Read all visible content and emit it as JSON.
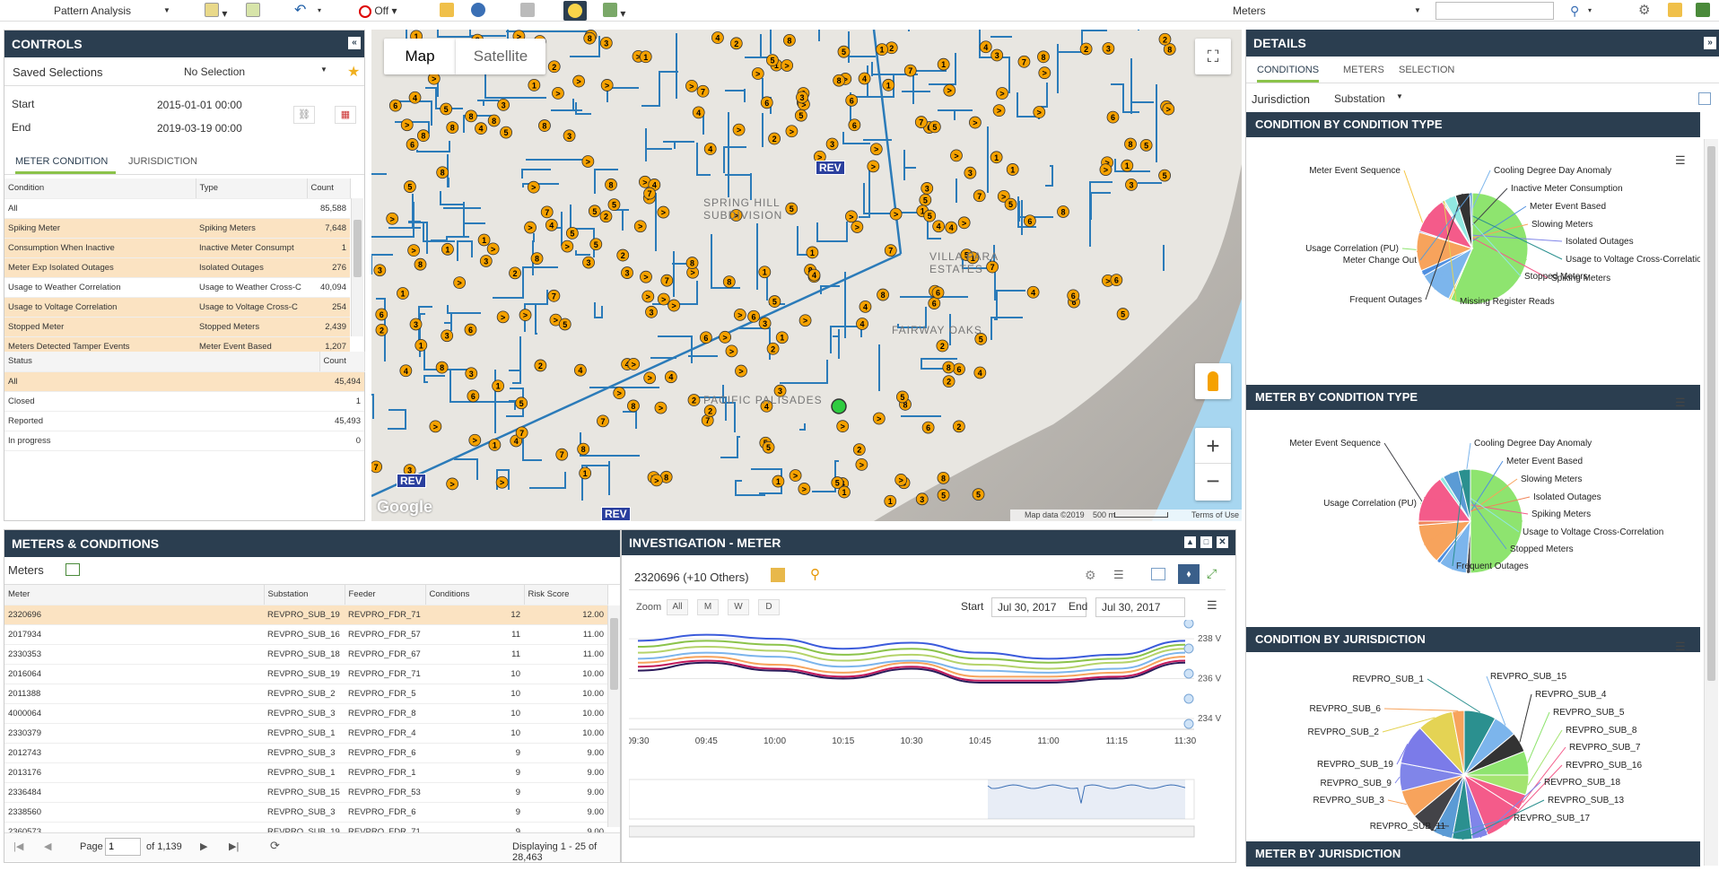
{
  "toolbar": {
    "view_selector": "Pattern Analysis",
    "alerts_toggle": "Off",
    "layer_selector": "Meters",
    "search_placeholder": ""
  },
  "controls": {
    "title": "CONTROLS",
    "saved_selections_label": "Saved Selections",
    "saved_selections_value": "No Selection",
    "start_label": "Start",
    "start_value": "2015-01-01 00:00",
    "end_label": "End",
    "end_value": "2019-03-19 00:00",
    "tabs": [
      "METER CONDITION",
      "JURISDICTION"
    ],
    "condition_headers": [
      "Condition",
      "Type",
      "Count"
    ],
    "conditions": [
      {
        "condition": "All",
        "type": "",
        "count": "85,588"
      },
      {
        "condition": "Spiking Meter",
        "type": "Spiking Meters",
        "count": "7,648"
      },
      {
        "condition": "Consumption When Inactive",
        "type": "Inactive Meter Consumpt",
        "count": "1"
      },
      {
        "condition": "Meter Exp Isolated Outages",
        "type": "Isolated Outages",
        "count": "276"
      },
      {
        "condition": "Usage to Weather Correlation",
        "type": "Usage to Weather Cross-C",
        "count": "40,094"
      },
      {
        "condition": "Usage to Voltage Correlation",
        "type": "Usage to Voltage Cross-C",
        "count": "254"
      },
      {
        "condition": "Stopped Meter",
        "type": "Stopped Meters",
        "count": "2,439"
      },
      {
        "condition": "Meters Detected Tamper Events",
        "type": "Meter Event Based",
        "count": "1,207"
      }
    ],
    "status_headers": [
      "Status",
      "Count"
    ],
    "statuses": [
      {
        "status": "All",
        "count": "45,494"
      },
      {
        "status": "Closed",
        "count": "1"
      },
      {
        "status": "Reported",
        "count": "45,493"
      },
      {
        "status": "In progress",
        "count": "0"
      }
    ]
  },
  "map": {
    "map_type_tabs": [
      "Map",
      "Satellite"
    ],
    "place_labels": [
      "SPRING HILL SUBDIVISION",
      "VILLA PARA ESTATES",
      "PACIFIC PALISADES",
      "FAIRWAY OAKS"
    ],
    "attribution": "Map data ©2019",
    "scale": "500 m",
    "terms": "Terms of Use",
    "logo": "Google",
    "rev_badges": [
      "REV",
      "REV",
      "REV"
    ]
  },
  "meters_conditions": {
    "title": "METERS & CONDITIONS",
    "subtitle": "Meters",
    "headers": [
      "Meter",
      "Substation",
      "Feeder",
      "Conditions",
      "Risk Score"
    ],
    "rows": [
      {
        "meter": "2320696",
        "substation": "REVPRO_SUB_19",
        "feeder": "REVPRO_FDR_71",
        "conditions": "12",
        "risk": "12.00"
      },
      {
        "meter": "2017934",
        "substation": "REVPRO_SUB_16",
        "feeder": "REVPRO_FDR_57",
        "conditions": "11",
        "risk": "11.00"
      },
      {
        "meter": "2330353",
        "substation": "REVPRO_SUB_18",
        "feeder": "REVPRO_FDR_67",
        "conditions": "11",
        "risk": "11.00"
      },
      {
        "meter": "2016064",
        "substation": "REVPRO_SUB_19",
        "feeder": "REVPRO_FDR_71",
        "conditions": "10",
        "risk": "10.00"
      },
      {
        "meter": "2011388",
        "substation": "REVPRO_SUB_2",
        "feeder": "REVPRO_FDR_5",
        "conditions": "10",
        "risk": "10.00"
      },
      {
        "meter": "4000064",
        "substation": "REVPRO_SUB_3",
        "feeder": "REVPRO_FDR_8",
        "conditions": "10",
        "risk": "10.00"
      },
      {
        "meter": "2330379",
        "substation": "REVPRO_SUB_1",
        "feeder": "REVPRO_FDR_4",
        "conditions": "10",
        "risk": "10.00"
      },
      {
        "meter": "2012743",
        "substation": "REVPRO_SUB_3",
        "feeder": "REVPRO_FDR_6",
        "conditions": "9",
        "risk": "9.00"
      },
      {
        "meter": "2013176",
        "substation": "REVPRO_SUB_1",
        "feeder": "REVPRO_FDR_1",
        "conditions": "9",
        "risk": "9.00"
      },
      {
        "meter": "2336484",
        "substation": "REVPRO_SUB_15",
        "feeder": "REVPRO_FDR_53",
        "conditions": "9",
        "risk": "9.00"
      },
      {
        "meter": "2338560",
        "substation": "REVPRO_SUB_3",
        "feeder": "REVPRO_FDR_6",
        "conditions": "9",
        "risk": "9.00"
      },
      {
        "meter": "2360573",
        "substation": "REVPRO_SUB_19",
        "feeder": "REVPRO_FDR_71",
        "conditions": "9",
        "risk": "9.00"
      }
    ],
    "pager": {
      "page_label": "Page",
      "page": "1",
      "of": "of 1,139",
      "displaying": "Displaying 1 - 25 of 28,463"
    }
  },
  "investigation": {
    "title": "INVESTIGATION - METER",
    "meter_label": "2320696 (+10 Others)",
    "zoom_label": "Zoom",
    "zoom_buttons": [
      "All",
      "M",
      "W",
      "D"
    ],
    "start_label": "Start",
    "start_value": "Jul 30, 2017",
    "end_label": "End",
    "end_value": "Jul 30, 2017",
    "y_ticks": [
      "238 V",
      "236 V",
      "234 V"
    ],
    "x_ticks": [
      "09:30",
      "09:45",
      "10:00",
      "10:15",
      "10:30",
      "10:45",
      "11:00",
      "11:15",
      "11:30"
    ]
  },
  "details": {
    "title": "DETAILS",
    "tabs": [
      "CONDITIONS",
      "METERS",
      "SELECTION"
    ],
    "jurisdiction_label": "Jurisdiction",
    "jurisdiction_value": "Substation",
    "chart1_title": "CONDITION BY CONDITION TYPE",
    "chart2_title": "METER BY CONDITION TYPE",
    "chart3_title": "CONDITION BY JURISDICTION",
    "chart4_title": "METER BY JURISDICTION",
    "chart1_labels": [
      "Meter Event Sequence",
      "Cooling Degree Day Anomaly",
      "Inactive Meter Consumption",
      "Meter Event Based",
      "Slowing Meters",
      "Usage Correlation (PU)",
      "Isolated Outages",
      "Meter Change Out",
      "Spiking Meters",
      "Frequent Outages",
      "Usage to Voltage Cross-Correlation",
      "Stopped Meters",
      "Missing Register Reads"
    ],
    "chart2_labels": [
      "Meter Event Sequence",
      "Cooling Degree Day Anomaly",
      "Meter Event Based",
      "Slowing Meters",
      "Isolated Outages",
      "Usage Correlation (PU)",
      "Spiking Meters",
      "Usage to Voltage Cross-Correlation",
      "Stopped Meters",
      "Frequent Outages"
    ],
    "chart3_labels": [
      "REVPRO_SUB_1",
      "REVPRO_SUB_15",
      "REVPRO_SUB_4",
      "REVPRO_SUB_6",
      "REVPRO_SUB_5",
      "REVPRO_SUB_8",
      "REVPRO_SUB_2",
      "REVPRO_SUB_7",
      "REVPRO_SUB_16",
      "REVPRO_SUB_19",
      "REVPRO_SUB_18",
      "REVPRO_SUB_9",
      "REVPRO_SUB_13",
      "REVPRO_SUB_3",
      "REVPRO_SUB_17",
      "REVPRO_SUB_11"
    ]
  },
  "colors": {
    "header_bg": "#2b3e50",
    "accent": "#8bc34a",
    "highlight_row": "#fbe3c2",
    "marker": "#f5a100",
    "pipe": "#2b7bb9"
  },
  "chart_data": [
    {
      "type": "pie",
      "title": "CONDITION BY CONDITION TYPE",
      "series": [
        {
          "values": [
            {
              "label": "Usage Correlation (PU)",
              "value": 40094
            },
            {
              "label": "Meter Event Sequence",
              "value": 400
            },
            {
              "label": "Cooling Degree Day Anomaly",
              "value": 7000
            },
            {
              "label": "Inactive Meter Consumption",
              "value": 1
            },
            {
              "label": "Meter Event Based",
              "value": 1207
            },
            {
              "label": "Slowing Meters",
              "value": 8000
            },
            {
              "label": "Isolated Outages",
              "value": 276
            },
            {
              "label": "Spiking Meters",
              "value": 7648
            },
            {
              "label": "Usage to Voltage Cross-Correlation",
              "value": 254
            },
            {
              "label": "Missing Register Reads",
              "value": 300
            },
            {
              "label": "Stopped Meters",
              "value": 2439
            },
            {
              "label": "Frequent Outages",
              "value": 3000
            },
            {
              "label": "Meter Change Out",
              "value": 500
            }
          ]
        }
      ]
    },
    {
      "type": "pie",
      "title": "METER BY CONDITION TYPE",
      "series": [
        {
          "values": [
            {
              "label": "Usage Correlation (PU)",
              "value": 40
            },
            {
              "label": "Meter Event Sequence",
              "value": 1
            },
            {
              "label": "Cooling Degree Day Anomaly",
              "value": 7
            },
            {
              "label": "Meter Event Based",
              "value": 1
            },
            {
              "label": "Slowing Meters",
              "value": 10
            },
            {
              "label": "Isolated Outages",
              "value": 1
            },
            {
              "label": "Spiking Meters",
              "value": 12
            },
            {
              "label": "Usage to Voltage Cross-Correlation",
              "value": 1
            },
            {
              "label": "Stopped Meters",
              "value": 4
            },
            {
              "label": "Frequent Outages",
              "value": 3
            }
          ]
        }
      ]
    },
    {
      "type": "pie",
      "title": "CONDITION BY JURISDICTION",
      "series": [
        {
          "values": [
            {
              "label": "REVPRO_SUB_1",
              "value": 8
            },
            {
              "label": "REVPRO_SUB_15",
              "value": 6
            },
            {
              "label": "REVPRO_SUB_4",
              "value": 5
            },
            {
              "label": "REVPRO_SUB_5",
              "value": 6
            },
            {
              "label": "REVPRO_SUB_8",
              "value": 5
            },
            {
              "label": "REVPRO_SUB_7",
              "value": 4
            },
            {
              "label": "REVPRO_SUB_16",
              "value": 10
            },
            {
              "label": "REVPRO_SUB_18",
              "value": 4
            },
            {
              "label": "REVPRO_SUB_13",
              "value": 5
            },
            {
              "label": "REVPRO_SUB_17",
              "value": 5
            },
            {
              "label": "REVPRO_SUB_11",
              "value": 6
            },
            {
              "label": "REVPRO_SUB_3",
              "value": 7
            },
            {
              "label": "REVPRO_SUB_9",
              "value": 7
            },
            {
              "label": "REVPRO_SUB_19",
              "value": 10
            },
            {
              "label": "REVPRO_SUB_2",
              "value": 9
            },
            {
              "label": "REVPRO_SUB_6",
              "value": 3
            }
          ]
        }
      ]
    },
    {
      "type": "line",
      "title": "INVESTIGATION - METER",
      "x": [
        "09:30",
        "09:45",
        "10:00",
        "10:15",
        "10:30",
        "10:45",
        "11:00",
        "11:15",
        "11:30"
      ],
      "ylim": [
        234,
        238.5
      ],
      "series": [
        {
          "values": [
            237.9,
            238.2,
            238.0,
            237.5,
            237.8,
            237.3,
            237.0,
            237.2,
            237.9
          ]
        },
        {
          "values": [
            237.6,
            237.9,
            237.7,
            237.2,
            237.5,
            237.0,
            236.8,
            237.0,
            237.7
          ]
        },
        {
          "values": [
            237.3,
            237.6,
            237.4,
            236.9,
            237.2,
            236.7,
            236.5,
            236.8,
            237.5
          ]
        },
        {
          "values": [
            237.0,
            237.3,
            237.1,
            236.6,
            236.9,
            236.4,
            236.3,
            236.5,
            237.3
          ]
        },
        {
          "values": [
            236.8,
            237.1,
            236.7,
            236.3,
            236.8,
            236.1,
            236.1,
            236.3,
            237.1
          ]
        },
        {
          "values": [
            236.6,
            236.9,
            236.5,
            236.1,
            236.6,
            235.9,
            235.9,
            236.1,
            236.9
          ]
        },
        {
          "values": [
            236.4,
            236.8,
            236.4,
            236.0,
            236.5,
            235.8,
            235.8,
            236.0,
            236.8
          ]
        }
      ]
    }
  ]
}
